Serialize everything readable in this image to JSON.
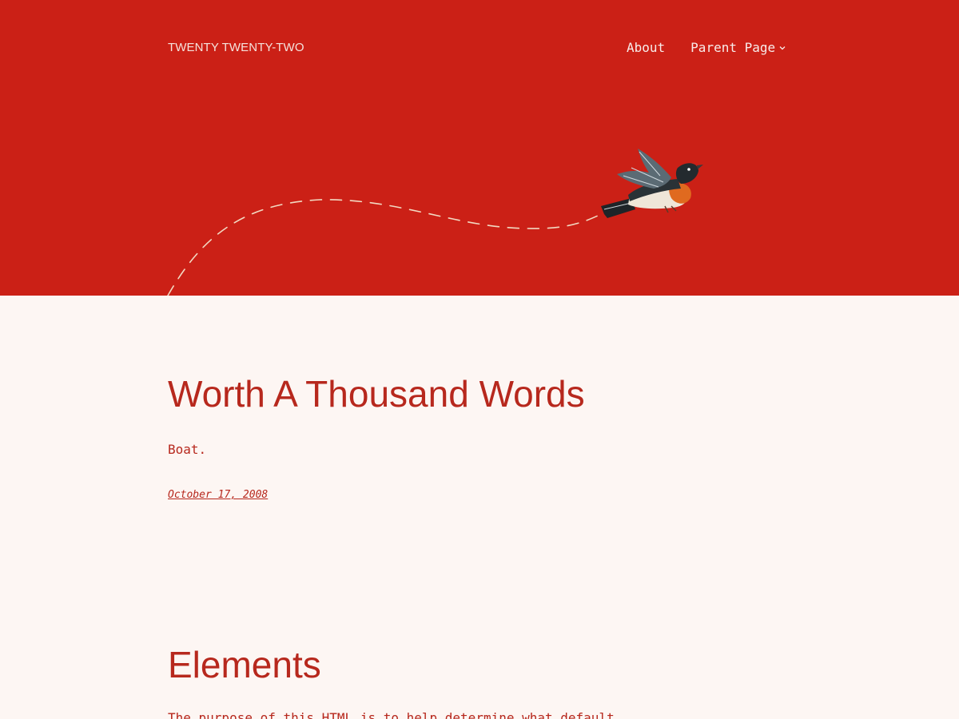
{
  "site": {
    "title": "TWENTY TWENTY-TWO"
  },
  "nav": {
    "items": [
      {
        "label": "About"
      },
      {
        "label": "Parent Page",
        "icon": "chevron-down-icon"
      }
    ]
  },
  "hero": {
    "illustration": "flying-bird-with-dashed-flight-path",
    "colors": {
      "background": "#cb2016",
      "path": "#f2d9c2"
    }
  },
  "post": {
    "title": "Worth A Thousand Words",
    "excerpt": "Boat.",
    "date": "October 17, 2008"
  },
  "next_section": {
    "title": "Elements",
    "body": "The purpose of this HTML is to help determine what default"
  },
  "colors": {
    "accent": "#b7281d",
    "page_background": "#fdf6f3"
  }
}
